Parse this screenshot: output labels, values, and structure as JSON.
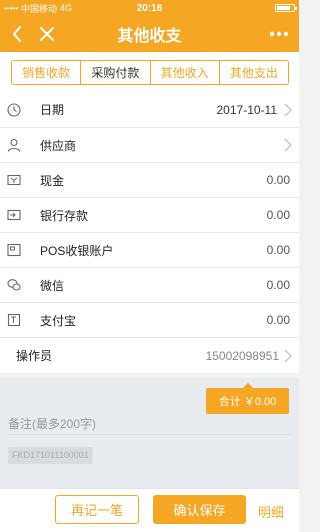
{
  "status_bar": {
    "carrier": "中国移动",
    "network": "4G",
    "time": "20:16",
    "battery_level": 0.8
  },
  "nav": {
    "title": "其他收支",
    "back_icon": "chevron-left-icon",
    "close_icon": "close-icon",
    "more_icon": "more-dots-icon"
  },
  "tabs": [
    {
      "label": "销售收款",
      "active": false
    },
    {
      "label": "采购付款",
      "active": true
    },
    {
      "label": "其他收入",
      "active": false
    },
    {
      "label": "其他支出",
      "active": false
    }
  ],
  "form": {
    "date": {
      "label": "日期",
      "value": "2017-10-11"
    },
    "supplier": {
      "label": "供应商",
      "value": ""
    },
    "accounts": [
      {
        "label": "现金",
        "value": "0.00"
      },
      {
        "label": "银行存款",
        "value": "0.00"
      },
      {
        "label": "POS收银账户",
        "value": "0.00"
      },
      {
        "label": "微信",
        "value": "0.00"
      },
      {
        "label": "支付宝",
        "value": "0.00"
      }
    ],
    "operator": {
      "label": "操作员",
      "value": "15002098951"
    }
  },
  "total": {
    "label": "合计 ￥0.00"
  },
  "remark": {
    "placeholder": "备注(最多200字)"
  },
  "doc_code": "FKD171011100001",
  "footer": {
    "secondary_label": "再记一笔",
    "primary_label": "确认保存",
    "link_label": "明细"
  },
  "colors": {
    "accent": "#f5a623",
    "background": "#f2f2f2",
    "grey_area": "#e8ecf0"
  }
}
